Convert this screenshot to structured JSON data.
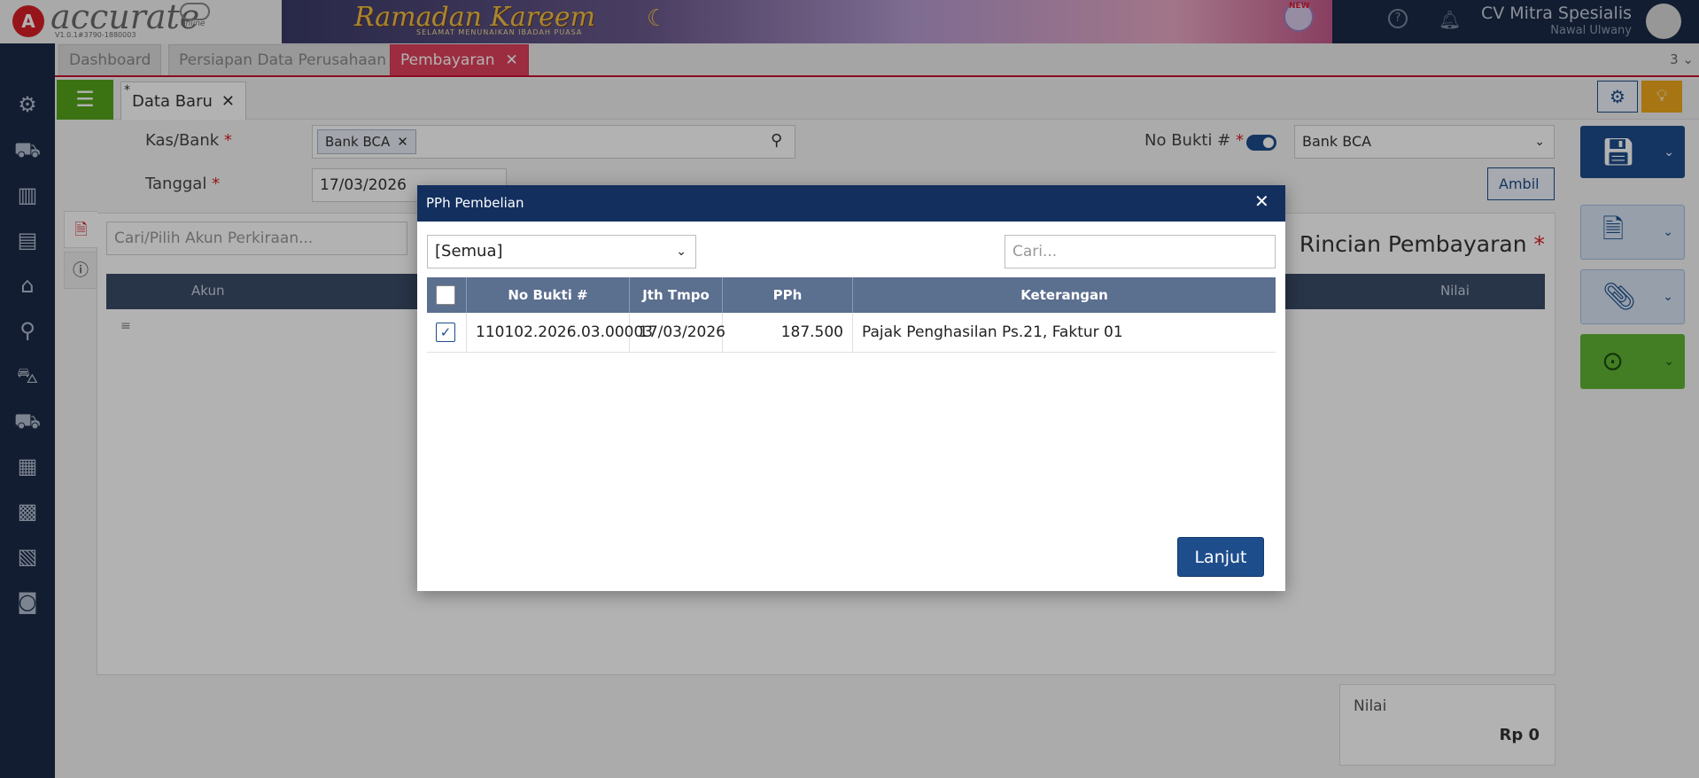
{
  "header": {
    "logo_text": "accurate",
    "logo_sub": "online",
    "version": "V1.0.1#3790-1880003",
    "banner_title": "Ramadan Kareem",
    "banner_sub": "SELAMAT MENUNAIKAN IBADAH PUASA",
    "banner_badge": "NEW",
    "company": "CV Mitra Spesialis",
    "user": "Nawal Ulwany"
  },
  "tabs": [
    {
      "label": "Dashboard"
    },
    {
      "label": "Persiapan Data Perusahaan"
    },
    {
      "label": "Pembayaran",
      "active": true
    }
  ],
  "tab_count": "3",
  "doc_tab": {
    "label": "Data Baru",
    "modified_mark": "*"
  },
  "form": {
    "kas_label": "Kas/Bank",
    "kas_value": "Bank BCA",
    "tanggal_label": "Tanggal",
    "tanggal_value": "17/03/2026",
    "nobukti_label": "No Bukti #",
    "nobukti_value": "Bank BCA",
    "ambil_label": "Ambil",
    "required_mark": "*"
  },
  "detail": {
    "akun_placeholder": "Cari/Pilih Akun Perkiraan...",
    "title": "Rincian Pembayaran",
    "col_akun": "Akun",
    "col_nilai": "Nilai",
    "nilai_label": "Nilai",
    "nilai_value": "Rp 0"
  },
  "modal": {
    "title": "PPh Pembelian",
    "filter_value": "[Semua]",
    "search_placeholder": "Cari...",
    "columns": [
      "No Bukti #",
      "Jth Tmpo PPh",
      "PPh",
      "Keterangan"
    ],
    "rows": [
      {
        "checked": true,
        "no_bukti": "110102.2026.03.00003",
        "jth_tmpo": "17/03/2026",
        "pph": "187.500",
        "keterangan": "Pajak Penghasilan Ps.21, Faktur 01"
      }
    ],
    "button": "Lanjut"
  },
  "icons": {
    "sidebar": [
      "gear-icon",
      "inbox-tray-icon",
      "building-icon",
      "book-icon",
      "bank-icon",
      "money-bag-icon",
      "cart-icon",
      "delivery-cart-icon",
      "factory-icon",
      "warehouse-icon",
      "tax-icon",
      "report-icon"
    ]
  },
  "colors": {
    "brand_red": "#d71f27",
    "navy": "#1e4d8c",
    "tab_active": "#e0415e",
    "green": "#55a51c"
  }
}
